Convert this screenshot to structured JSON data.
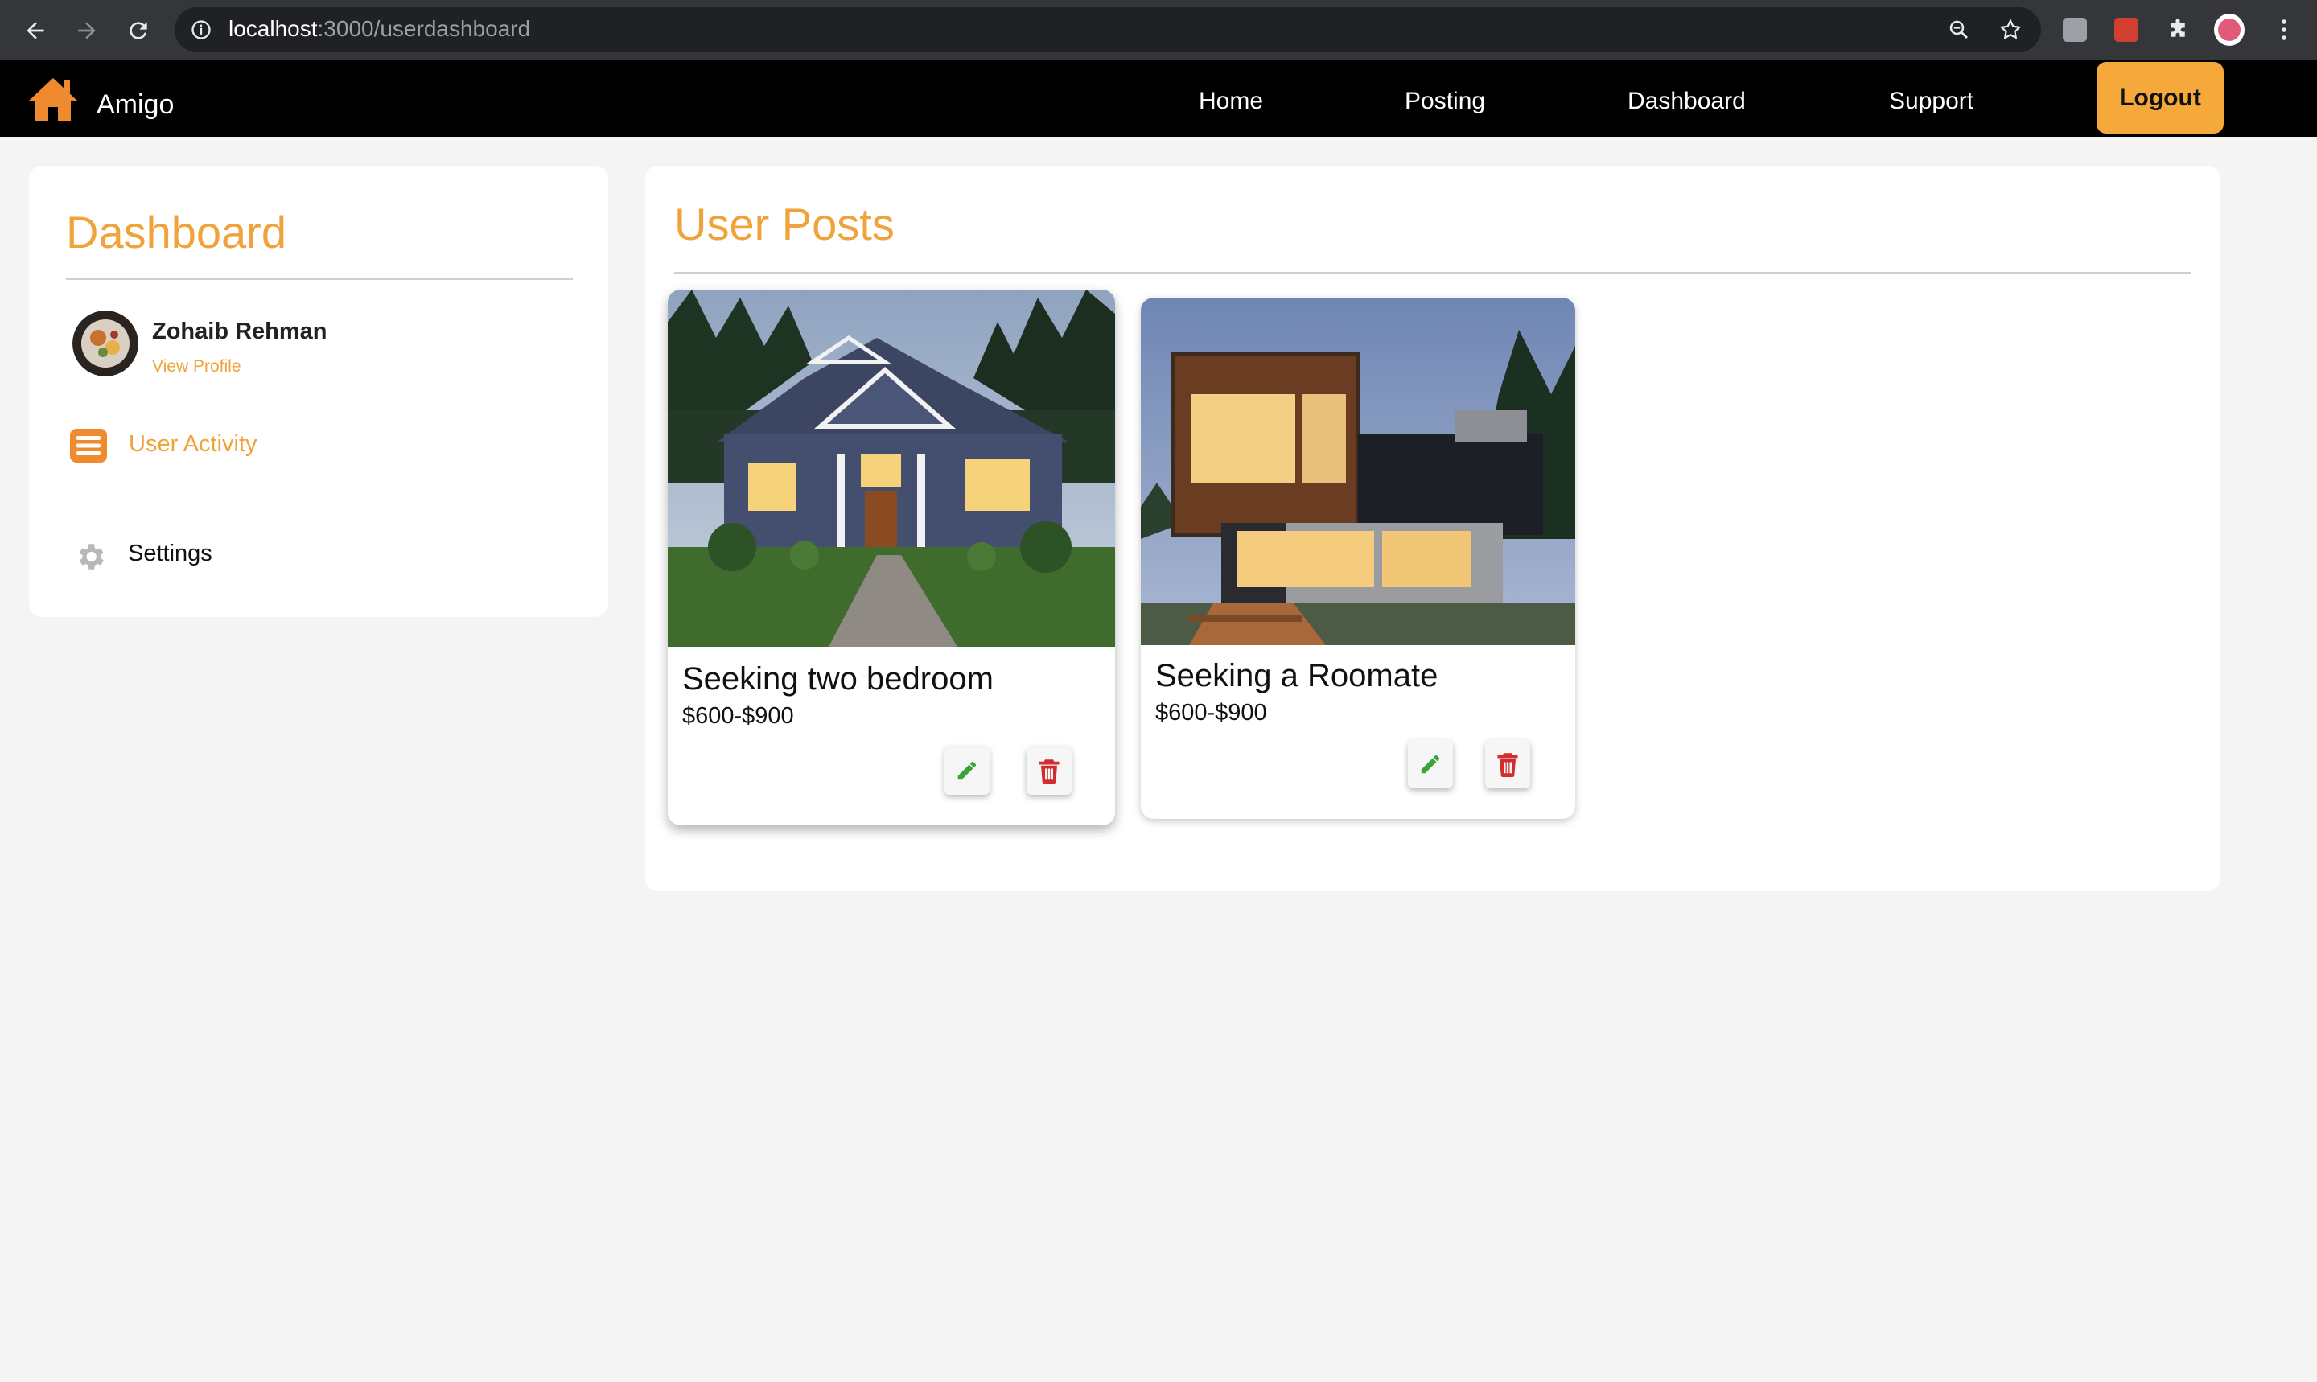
{
  "browser": {
    "url_host": "localhost",
    "url_path": ":3000/userdashboard"
  },
  "navbar": {
    "brand": "Amigo",
    "links": [
      "Home",
      "Posting",
      "Dashboard",
      "Support"
    ],
    "logout_label": "Logout",
    "accent_color": "#f5a93a"
  },
  "sidebar": {
    "title": "Dashboard",
    "user_name": "Zohaib Rehman",
    "view_profile": "View Profile",
    "items": [
      {
        "label": "User Activity",
        "icon": "list-icon",
        "active": true
      },
      {
        "label": "Settings",
        "icon": "gear-icon",
        "active": false
      }
    ]
  },
  "main": {
    "title": "User Posts",
    "posts": [
      {
        "title": "Seeking two bedroom",
        "price": "$600-$900",
        "image": "craftsman-house-photo"
      },
      {
        "title": "Seeking a Roomate",
        "price": "$600-$900",
        "image": "modern-house-photo"
      }
    ]
  },
  "colors": {
    "accent": "#f0a23b",
    "edit": "#3aa33a",
    "delete": "#d22d2d"
  }
}
